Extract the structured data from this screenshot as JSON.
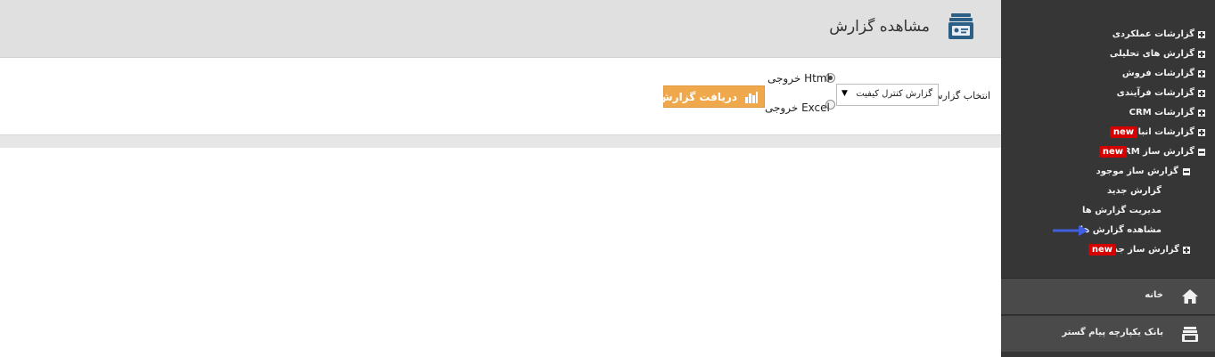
{
  "header": {
    "title": "مشاهده گزارش"
  },
  "form": {
    "select_label": "انتخاب گزارش",
    "selected_report": "گزارش کنترل کیفیت",
    "radio_html_label": "خروجی Html",
    "radio_excel_label": "خروجی Excel",
    "radio_html_checked": true,
    "get_report_button": "دریافت گزارش"
  },
  "sidebar": {
    "items": [
      {
        "label": "گزارشات عملکردی",
        "state": "collapsed"
      },
      {
        "label": "گزارش های تحلیلی",
        "state": "collapsed"
      },
      {
        "label": "گزارشات فروش",
        "state": "collapsed"
      },
      {
        "label": "گزارشات فرآیندی",
        "state": "collapsed"
      },
      {
        "label": "گزارشات CRM",
        "state": "collapsed"
      },
      {
        "label": "گزارشات انبار",
        "state": "collapsed",
        "badge": "new"
      },
      {
        "label": "گزارش ساز CRM",
        "state": "expanded",
        "badge": "new"
      }
    ],
    "subitems": [
      {
        "label": "گزارش ساز موجود",
        "state": "expanded"
      },
      {
        "label": "گزارش جدید"
      },
      {
        "label": "مدیریت گزارش ها"
      },
      {
        "label": "مشاهده گزارش ها",
        "active": true
      },
      {
        "label": "گزارش ساز جدید",
        "state": "collapsed",
        "badge": "new"
      }
    ],
    "home_label": "خانه",
    "bank_label": "بانک یکپارچه پیام گستر"
  },
  "colors": {
    "sidebar_bg": "#363636",
    "button_bg": "#f0a84d",
    "badge_bg": "#d50000",
    "arrow": "#3f5fe0"
  }
}
